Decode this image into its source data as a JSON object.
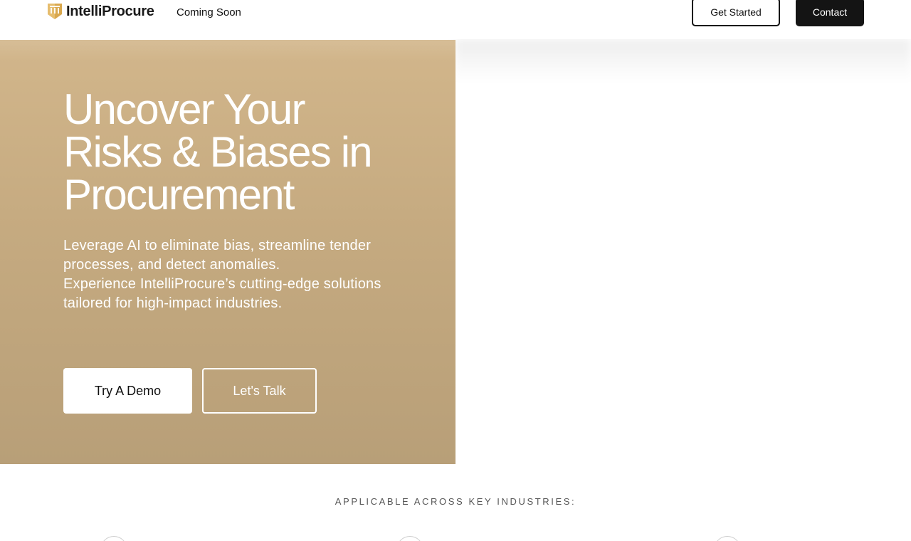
{
  "header": {
    "logo_text": "IntelliProcure",
    "logo_icon": "building-columns-icon",
    "nav": {
      "coming_soon": "Coming Soon"
    },
    "buttons": {
      "get_started": "Get Started",
      "contact": "Contact"
    }
  },
  "hero": {
    "title_lines": [
      "Uncover Your",
      "Risks & Biases in",
      "Procurement"
    ],
    "description_lines": [
      "Leverage AI to eliminate bias, streamline tender",
      "processes, and detect anomalies.",
      "Experience IntelliProcure’s cutting-edge solutions",
      "tailored for high-impact industries."
    ],
    "buttons": {
      "demo": "Try A Demo",
      "talk": "Let's Talk"
    }
  },
  "industries": {
    "heading": "APPLICABLE ACROSS KEY INDUSTRIES:"
  },
  "colors": {
    "hero_top": "#d2b68b",
    "hero_bottom": "#b89f78",
    "logo_gold": "#d4a24a",
    "dark_button": "#141414"
  }
}
